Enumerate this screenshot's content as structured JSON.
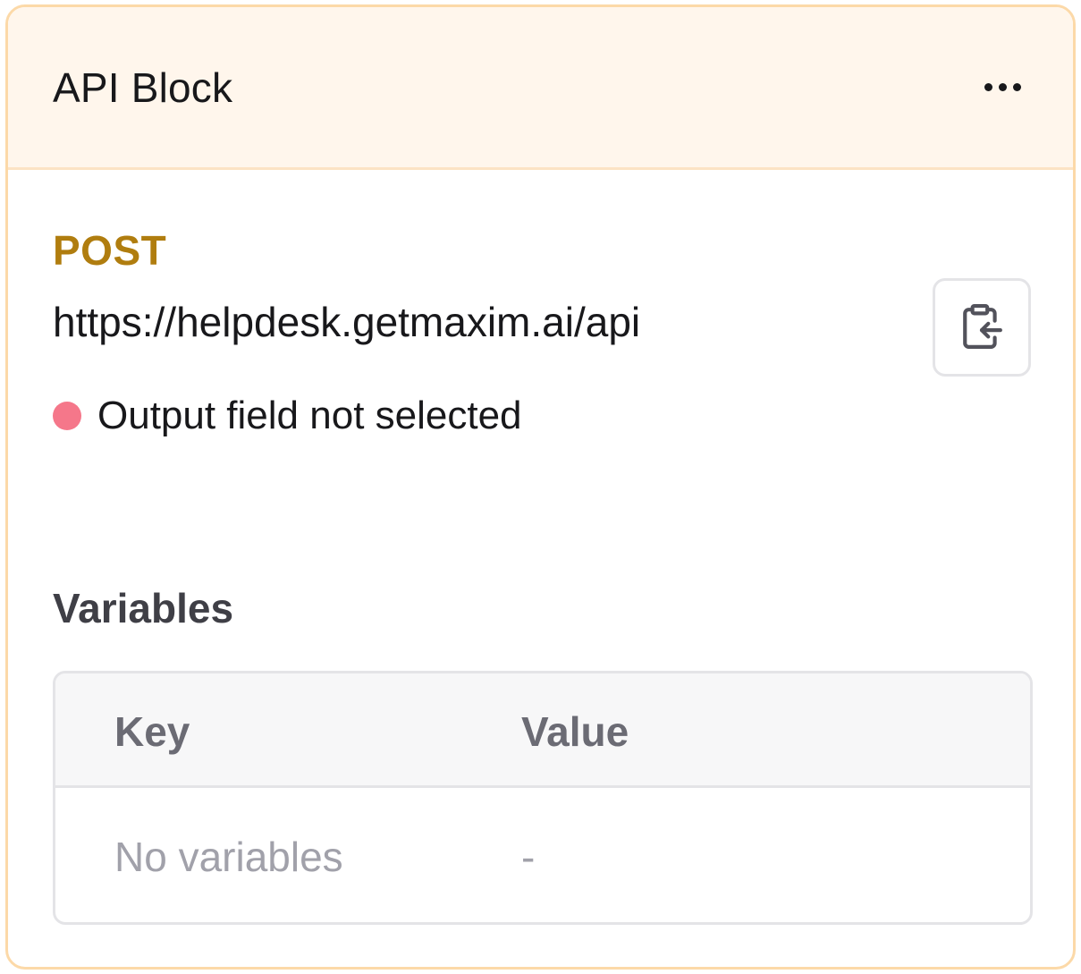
{
  "block": {
    "title": "API Block",
    "method": "POST",
    "url": "https://helpdesk.getmaxim.ai/api",
    "status_text": "Output field not selected"
  },
  "variables": {
    "title": "Variables",
    "columns": [
      "Key",
      "Value"
    ],
    "empty_key": "No variables",
    "empty_value": "-"
  },
  "icons": {
    "more": "more-horizontal-icon",
    "copy": "clipboard-copy-icon"
  },
  "colors": {
    "accent_border": "#fcd9a8",
    "header_bg": "#fff6ec",
    "method": "#b07d0f",
    "status_dot": "#f5778a"
  }
}
